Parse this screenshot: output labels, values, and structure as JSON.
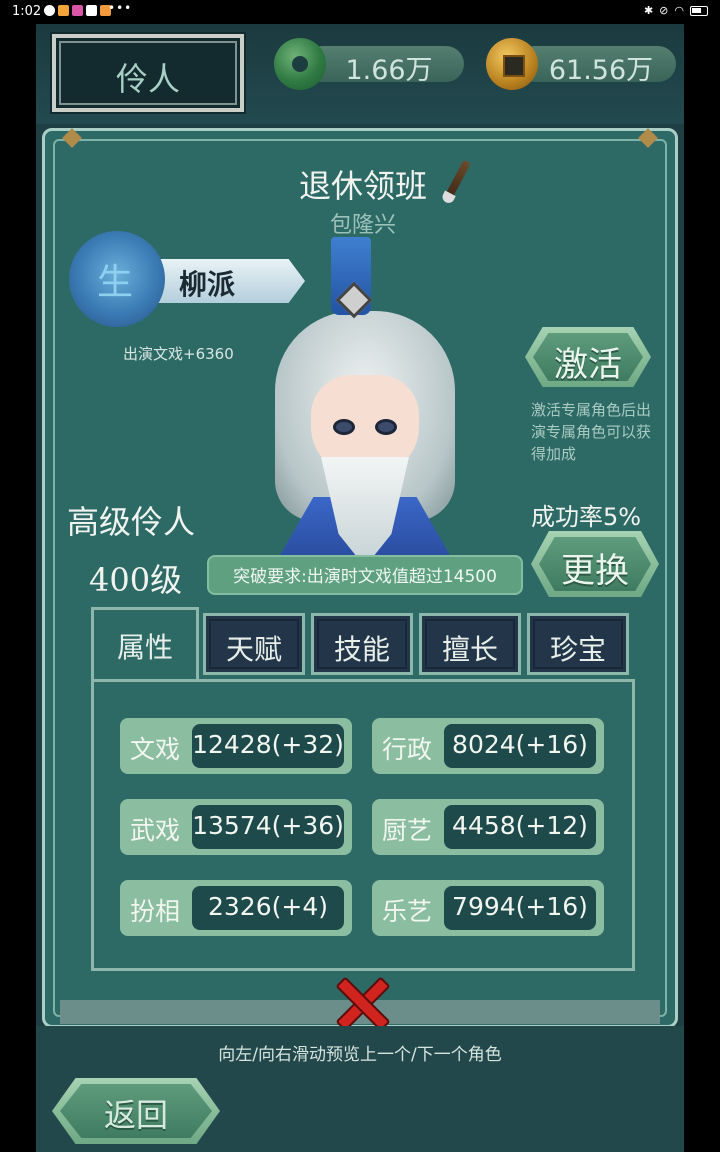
{
  "status_bar": {
    "time": "1:02",
    "dots": "•••"
  },
  "top": {
    "role_tab": "伶人",
    "jade_amount": "1.66万",
    "coin_amount": "61.56万"
  },
  "character": {
    "title": "退休领班",
    "name": "包隆兴",
    "school_badge": "生",
    "school": "柳派",
    "bonus": "出演文戏+6360",
    "rank": "高级伶人",
    "level": "400级",
    "breakthrough_requirement": "突破要求:出演时文戏值超过14500",
    "success_rate": "成功率5%"
  },
  "buttons": {
    "activate": "激活",
    "activate_note": "激活专属角色后出演专属角色可以获得加成",
    "change": "更换",
    "back": "返回"
  },
  "tabs": [
    "属性",
    "天赋",
    "技能",
    "擅长",
    "珍宝"
  ],
  "attributes": [
    {
      "name": "文戏",
      "value": "12428(+32)"
    },
    {
      "name": "行政",
      "value": "8024(+16)"
    },
    {
      "name": "武戏",
      "value": "13574(+36)"
    },
    {
      "name": "厨艺",
      "value": "4458(+12)"
    },
    {
      "name": "扮相",
      "value": "2326(+4)"
    },
    {
      "name": "乐艺",
      "value": "7994(+16)"
    }
  ],
  "hint": "向左/向右滑动预览上一个/下一个角色",
  "colors": {
    "panel": "#2d6a66",
    "accent_button": "#6ea884",
    "close": "#d1241f"
  }
}
